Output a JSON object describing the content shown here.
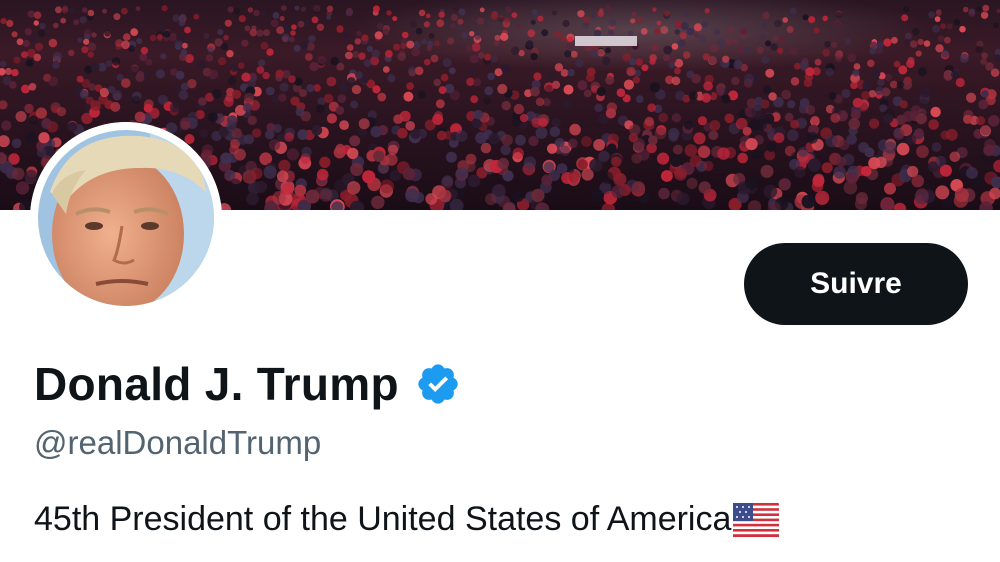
{
  "header": {
    "banner_icon": "crowd-photo-banner"
  },
  "profile": {
    "avatar_icon": "profile-avatar",
    "follow_label": "Suivre",
    "display_name": "Donald J. Trump",
    "verified_icon": "verified-badge-icon",
    "handle": "@realDonaldTrump",
    "bio": "45th President of the United States of America",
    "bio_emoji_icon": "us-flag-icon"
  },
  "colors": {
    "follow_button_bg": "#0f1419",
    "follow_button_text": "#ffffff",
    "verified_badge": "#1d9bf0",
    "handle_text": "#536471",
    "primary_text": "#0f1419"
  }
}
